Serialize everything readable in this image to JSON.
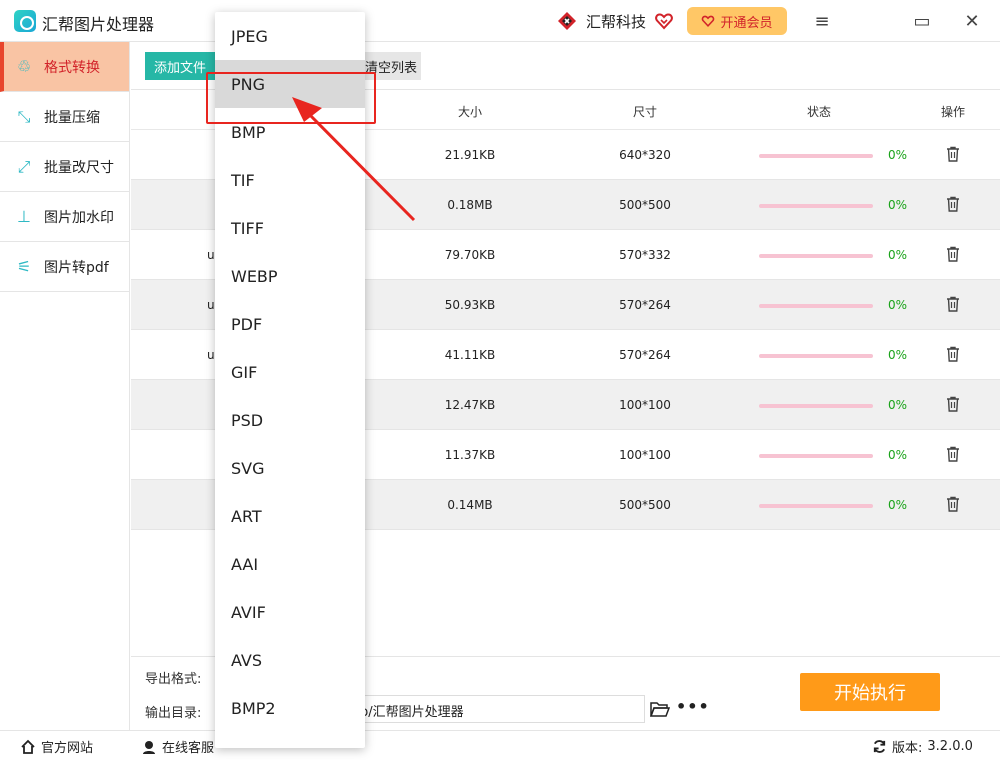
{
  "app": {
    "title": "汇帮图片处理器"
  },
  "header": {
    "brand_name": "汇帮科技",
    "vip_label": "开通会员",
    "menu_glyph": "≡",
    "maximize_glyph": "▭",
    "close_glyph": "✕"
  },
  "sidebar": {
    "items": [
      {
        "label": "格式转换",
        "icon": "convert-icon",
        "glyph": "♲"
      },
      {
        "label": "批量压缩",
        "icon": "compress-icon",
        "glyph": "⤡"
      },
      {
        "label": "批量改尺寸",
        "icon": "resize-icon",
        "glyph": "⤢"
      },
      {
        "label": "图片加水印",
        "icon": "watermark-icon",
        "glyph": "⊥"
      },
      {
        "label": "图片转pdf",
        "icon": "pdf-icon",
        "glyph": "⚟"
      }
    ]
  },
  "toolbar": {
    "add_label": "添加文件",
    "clear_label": "清空列表"
  },
  "table": {
    "headers": {
      "size": "大小",
      "dimensions": "尺寸",
      "status": "状态",
      "actions": "操作"
    },
    "rows": [
      {
        "name": "",
        "size": "21.91KB",
        "dim": "640*320",
        "pct": "0%",
        "progress": 0
      },
      {
        "name": "",
        "size": "0.18MB",
        "dim": "500*500",
        "pct": "0%",
        "progress": 0
      },
      {
        "name": "u",
        "size": "79.70KB",
        "dim": "570*332",
        "pct": "0%",
        "progress": 0
      },
      {
        "name": "u",
        "size": "50.93KB",
        "dim": "570*264",
        "pct": "0%",
        "progress": 0
      },
      {
        "name": "u",
        "size": "41.11KB",
        "dim": "570*264",
        "pct": "0%",
        "progress": 0
      },
      {
        "name": "",
        "size": "12.47KB",
        "dim": "100*100",
        "pct": "0%",
        "progress": 0
      },
      {
        "name": "",
        "size": "11.37KB",
        "dim": "100*100",
        "pct": "0%",
        "progress": 0
      },
      {
        "name": "",
        "size": "0.14MB",
        "dim": "500*500",
        "pct": "0%",
        "progress": 0
      }
    ]
  },
  "bottom": {
    "export_format_label": "导出格式:",
    "output_dir_label": "输出目录:",
    "output_path": "op/汇帮图片处理器",
    "more_glyph": "•••",
    "start_label": "开始执行"
  },
  "statusbar": {
    "website_label": "官方网站",
    "service_label": "在线客服",
    "version_label": "版本:",
    "version_value": "3.2.0.0"
  },
  "dropdown": {
    "selected": "PNG",
    "options": [
      "JPEG",
      "PNG",
      "BMP",
      "TIF",
      "TIFF",
      "WEBP",
      "PDF",
      "GIF",
      "PSD",
      "SVG",
      "ART",
      "AAI",
      "AVIF",
      "AVS",
      "BMP2"
    ]
  },
  "colors": {
    "accent_teal": "#26b7a6",
    "active_nav_bg": "#f9c4a4",
    "active_nav_text": "#d2232a",
    "start_button": "#ff9a18",
    "vip_button": "#ffc766",
    "annotation_red": "#e8251f",
    "progress_track": "#f7c3d2",
    "percent_text": "#1aa31a"
  }
}
